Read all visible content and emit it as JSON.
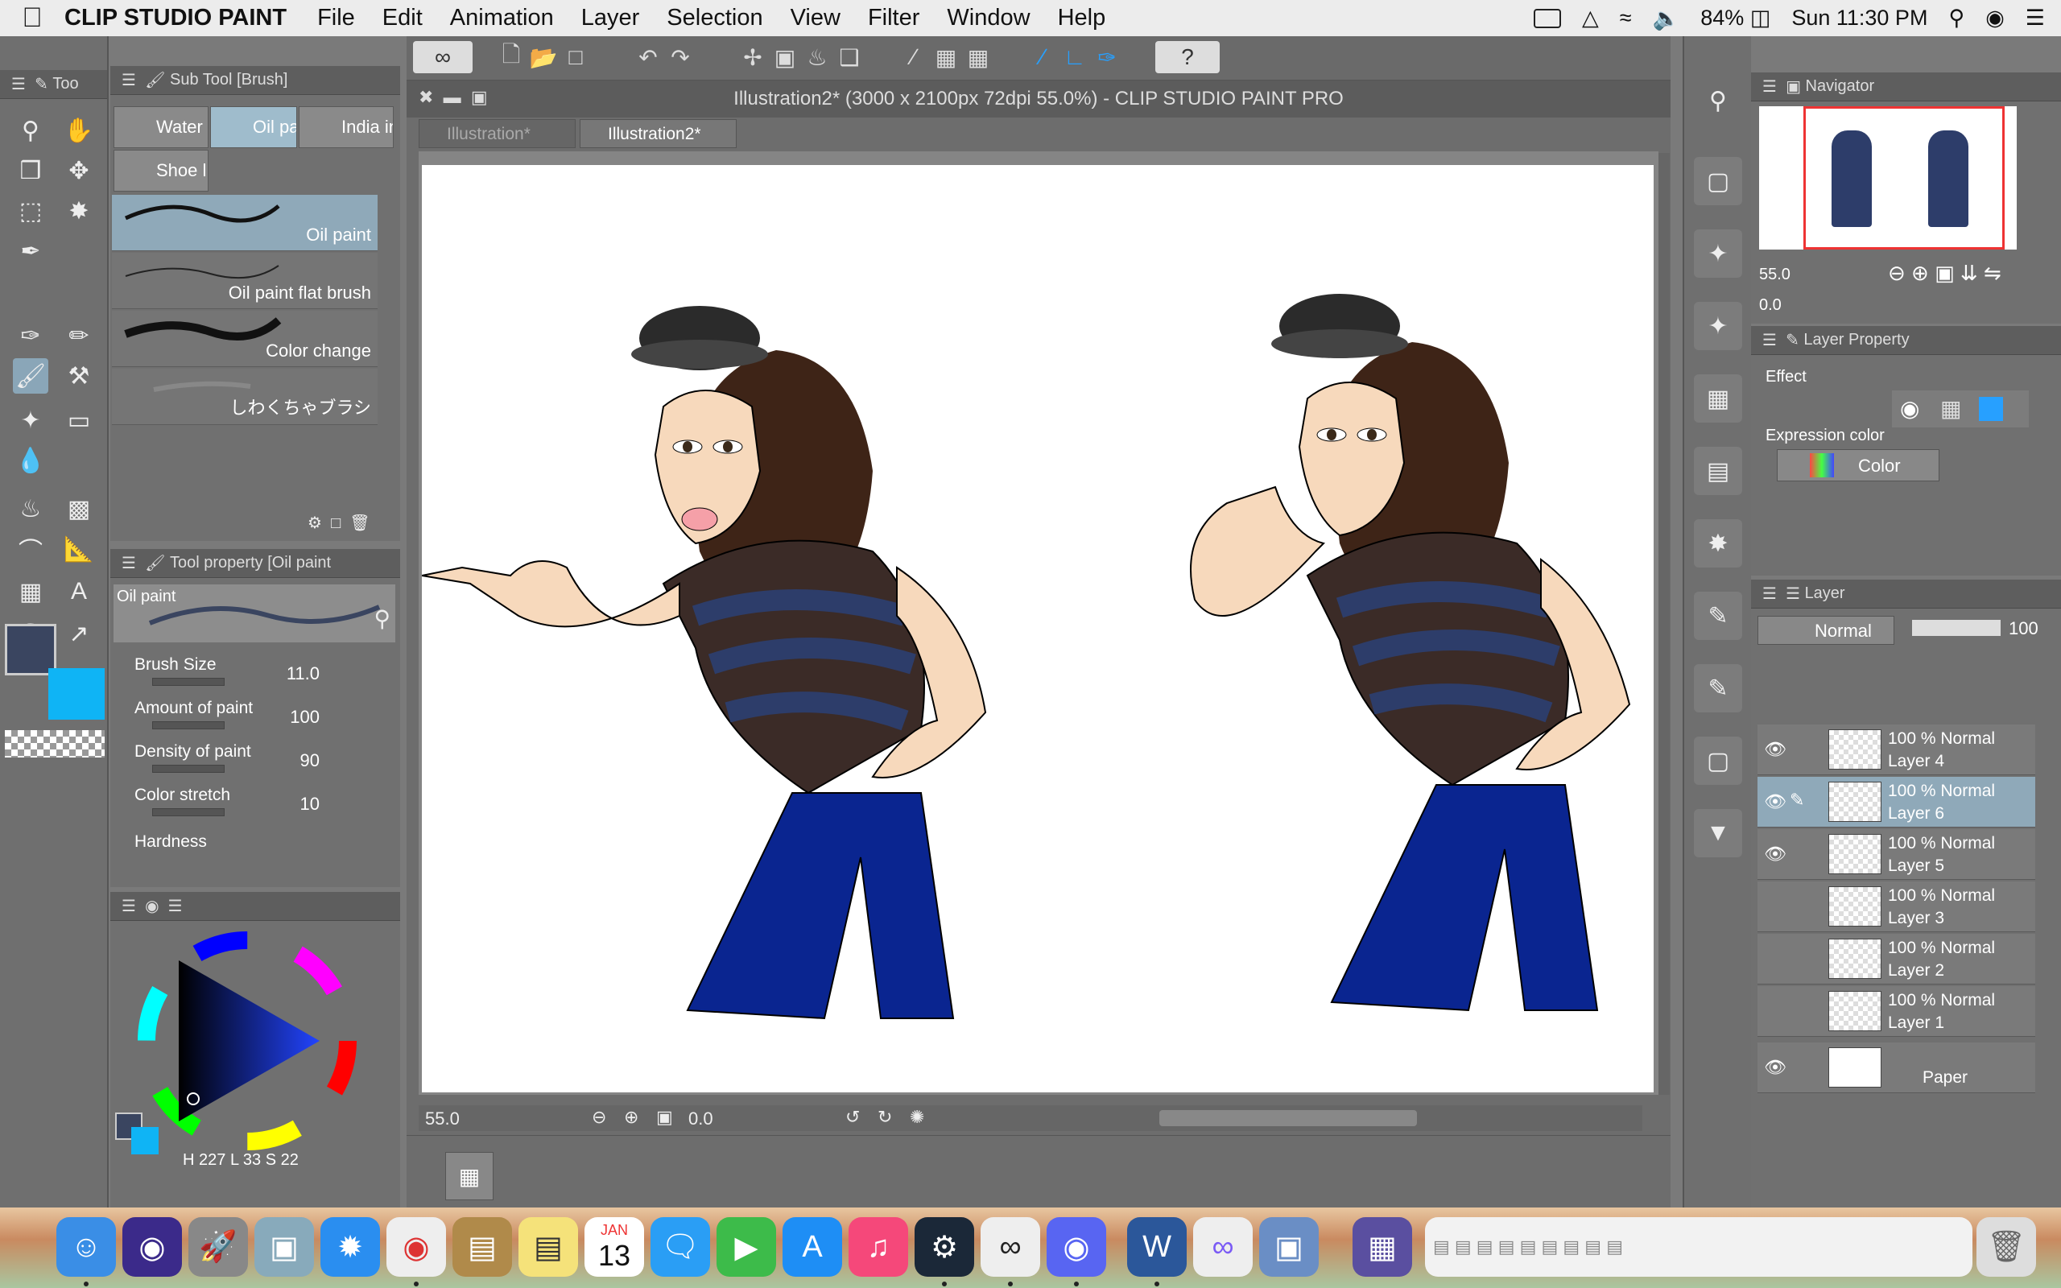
{
  "menubar": {
    "app_name": "CLIP STUDIO PAINT",
    "items": [
      "File",
      "Edit",
      "Animation",
      "Layer",
      "Selection",
      "View",
      "Filter",
      "Window",
      "Help"
    ],
    "battery": "84%",
    "clock": "Sun 11:30 PM"
  },
  "toolstrip": {
    "header": "Too"
  },
  "subtool": {
    "header": "Sub Tool [Brush]",
    "tabs": [
      "Water",
      "Oil pai",
      "India in",
      "Shoe l"
    ],
    "brushes": [
      "Oil paint",
      "Oil paint flat brush",
      "Color change",
      "しわくちゃブラシ"
    ]
  },
  "toolprop": {
    "header": "Tool property [Oil paint",
    "preview_label": "Oil paint",
    "props": [
      {
        "label": "Brush Size",
        "value": "11.0"
      },
      {
        "label": "Amount of paint",
        "value": "100"
      },
      {
        "label": "Density of paint",
        "value": "90"
      },
      {
        "label": "Color stretch",
        "value": "10"
      },
      {
        "label": "Hardness",
        "value": ""
      }
    ]
  },
  "color": {
    "main": "#3a4560",
    "sub": "#0fb4f5",
    "h_label": "H",
    "h": "227",
    "l_label": "L",
    "l": "33",
    "s_label": "S",
    "s": "22"
  },
  "canvas": {
    "title": "Illustration2* (3000 x 2100px 72dpi 55.0%)  - CLIP STUDIO PAINT PRO",
    "tabs": [
      "Illustration*",
      "Illustration2*"
    ],
    "zoom": "55.0",
    "rotation": "0.0"
  },
  "navigator": {
    "header": "Navigator",
    "zoom": "55.0",
    "rotation": "0.0"
  },
  "layerprop": {
    "header": "Layer Property",
    "effect_label": "Effect",
    "expression_label": "Expression color",
    "expression_value": "Color"
  },
  "layerpanel": {
    "header": "Layer",
    "blend_mode": "Normal",
    "opacity": "100",
    "layers": [
      {
        "mode": "100 % Normal",
        "name": "Layer 4",
        "visible": true,
        "active": false
      },
      {
        "mode": "100 % Normal",
        "name": "Layer 6",
        "visible": true,
        "active": true
      },
      {
        "mode": "100 % Normal",
        "name": "Layer 5",
        "visible": true,
        "active": false
      },
      {
        "mode": "100 % Normal",
        "name": "Layer 3",
        "visible": false,
        "active": false
      },
      {
        "mode": "100 % Normal",
        "name": "Layer 2",
        "visible": false,
        "active": false
      },
      {
        "mode": "100 % Normal",
        "name": "Layer 1",
        "visible": false,
        "active": false
      }
    ],
    "paper": "Paper"
  },
  "dock": {
    "calendar_month": "JAN",
    "calendar_day": "13",
    "apps": [
      "finder-icon",
      "siri-icon",
      "launchpad-icon",
      "preview-icon",
      "safari-icon",
      "chrome-icon",
      "contacts-icon",
      "notes-icon",
      "calendar-icon",
      "messages-icon",
      "facetime-icon",
      "appstore-icon",
      "music-icon",
      "steam-icon",
      "clipstudio-icon",
      "discord-icon",
      "word-icon",
      "creative-cloud-icon",
      "image-capture-icon",
      "gameboy-icon"
    ]
  }
}
